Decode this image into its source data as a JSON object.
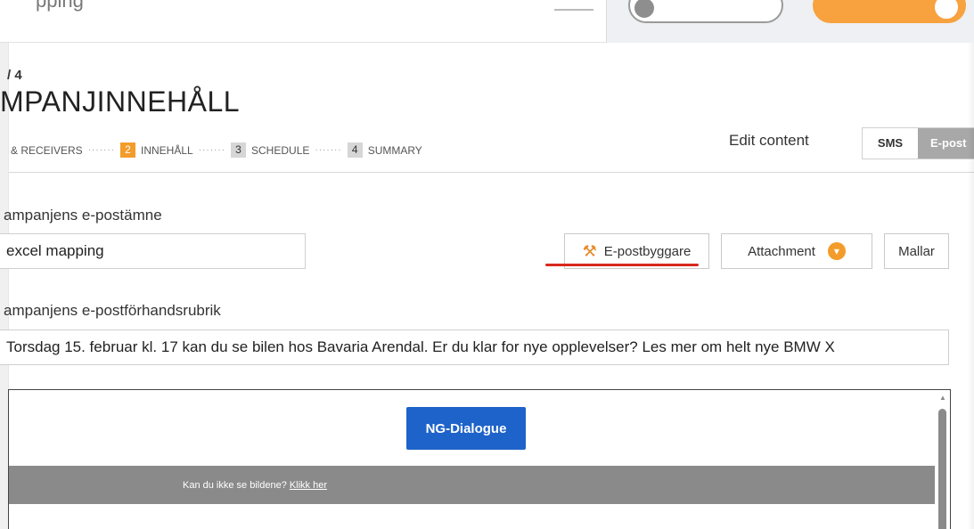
{
  "topbar": {
    "search_partial": "pping"
  },
  "heading": {
    "step_counter": "/ 4",
    "title": "MPANJINNEHÅLL"
  },
  "steps": [
    {
      "num": "",
      "label": "& RECEIVERS"
    },
    {
      "num": "2",
      "label": "INNEHÅLL"
    },
    {
      "num": "3",
      "label": "SCHEDULE"
    },
    {
      "num": "4",
      "label": "SUMMARY"
    }
  ],
  "steps_separator": "·······",
  "edit_content": {
    "label": "Edit content",
    "sms": "SMS",
    "email": "E-post"
  },
  "form": {
    "subject_label": "ampanjens e-postämne",
    "subject_value": "excel mapping",
    "preheader_label": "ampanjens e-postförhandsrubrik",
    "preheader_value": "Torsdag 15. februar kl. 17 kan du se bilen hos Bavaria Arendal. Er du klar for nye opplevelser? Les mer om helt nye BMW X"
  },
  "buttons": {
    "builder": "E-postbyggare",
    "builder_icon": "hammer-wrench-icon",
    "attachment": "Attachment",
    "templates": "Mallar"
  },
  "preview": {
    "cta": "NG-Dialogue",
    "banner_text": "Kan du ikke se bildene?",
    "banner_link": "Klikk her"
  },
  "colors": {
    "accent_orange": "#f39c2b",
    "cta_blue": "#1e63c9",
    "annotation_red": "#d9281c"
  }
}
